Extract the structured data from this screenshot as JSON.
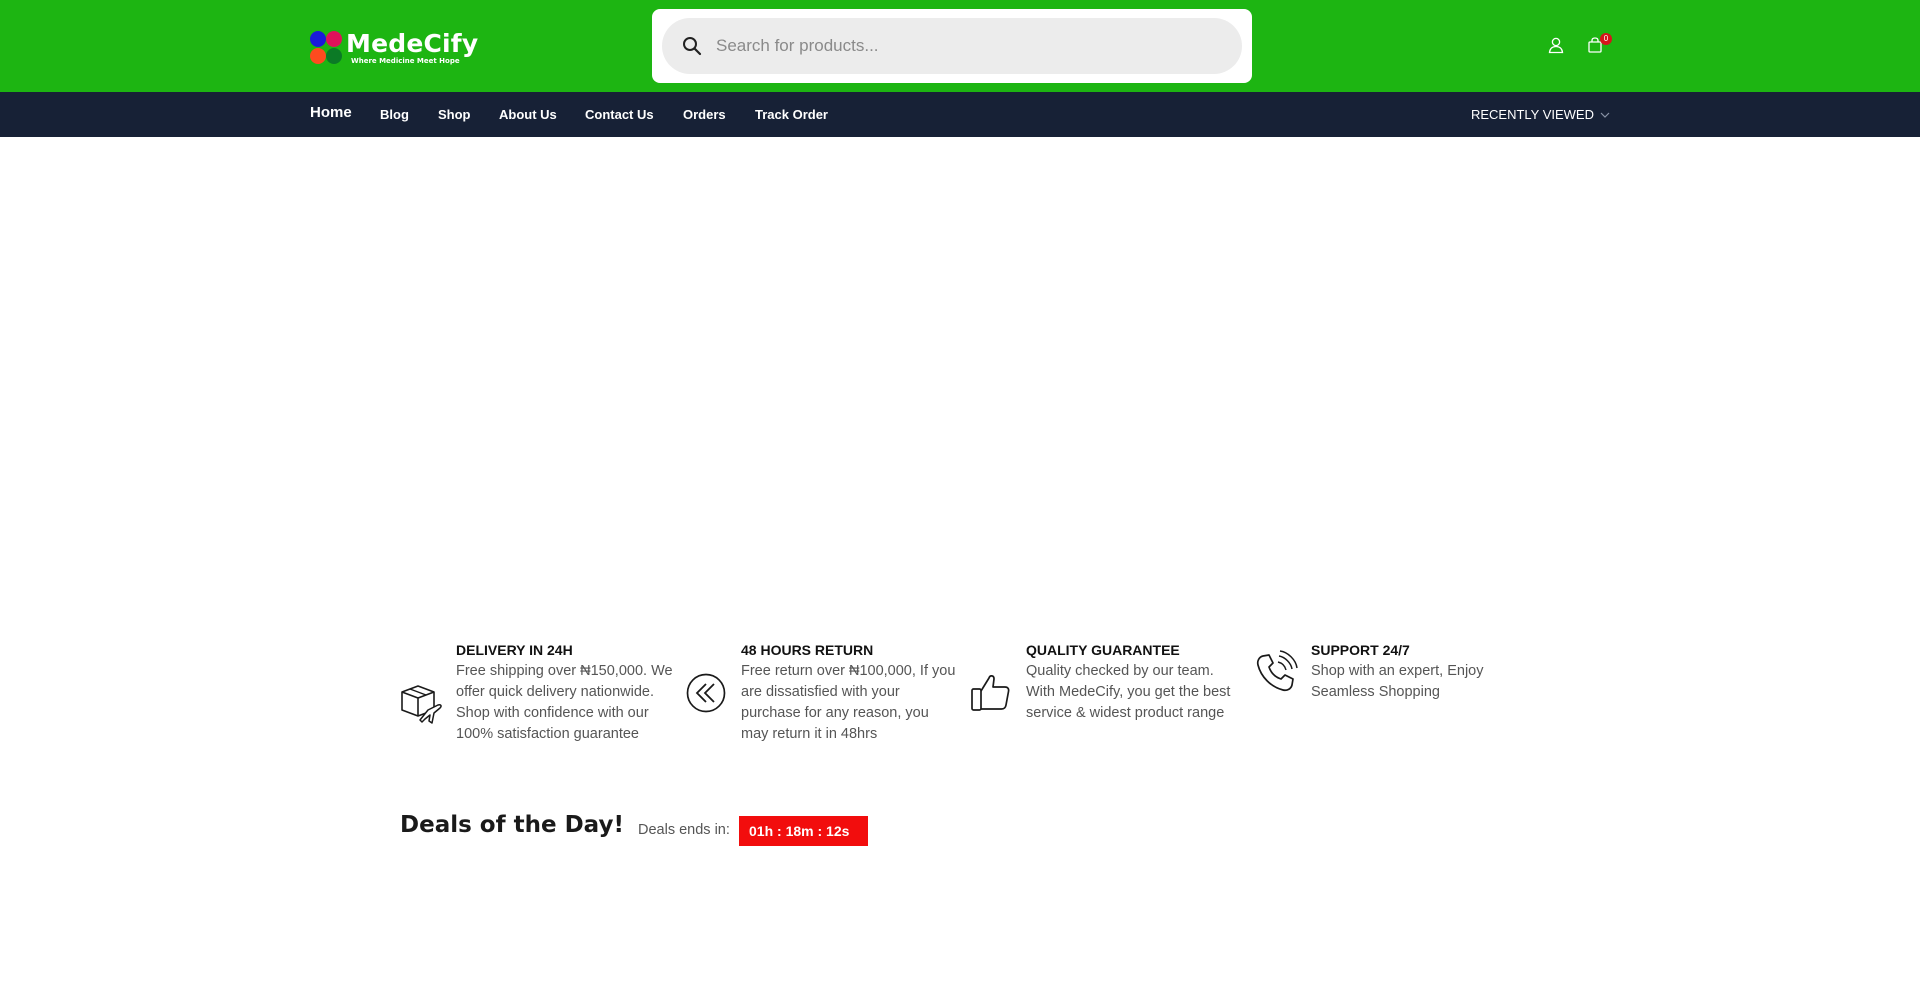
{
  "brand": {
    "name": "MedeCify",
    "tagline": "Where Medicine Meet Hope"
  },
  "search": {
    "placeholder": "Search for products..."
  },
  "header": {
    "cart_count": "0"
  },
  "nav": {
    "items": [
      {
        "label": "Home"
      },
      {
        "label": "Blog"
      },
      {
        "label": "Shop"
      },
      {
        "label": "About Us"
      },
      {
        "label": "Contact Us"
      },
      {
        "label": "Orders"
      },
      {
        "label": "Track Order"
      }
    ],
    "recently_viewed": "RECENTLY VIEWED"
  },
  "features": [
    {
      "icon": "delivery-box-plane-icon",
      "title": "DELIVERY IN 24H",
      "desc": "Free shipping over ₦150,000. We offer quick delivery nationwide. Shop with confidence with our 100% satisfaction guarantee"
    },
    {
      "icon": "return-arrows-icon",
      "title": "48 HOURS RETURN",
      "desc": "Free return over ₦100,000, If you are dissatisfied with your purchase for any reason, you may return it in 48hrs"
    },
    {
      "icon": "thumbs-up-icon",
      "title": "QUALITY GUARANTEE",
      "desc": "Quality checked by our team. With MedeCify, you get the best service & widest product range"
    },
    {
      "icon": "phone-support-icon",
      "title": "SUPPORT 24/7",
      "desc": "Shop with an expert, Enjoy Seamless Shopping"
    }
  ],
  "deals": {
    "title": "Deals of the Day!",
    "ends_label": "Deals ends in:",
    "timer": "01h : 18m : 12s"
  },
  "colors": {
    "header_green": "#1db512",
    "nav_navy": "#172136",
    "timer_red": "#f20d0d",
    "badge_red": "#d6151b"
  }
}
